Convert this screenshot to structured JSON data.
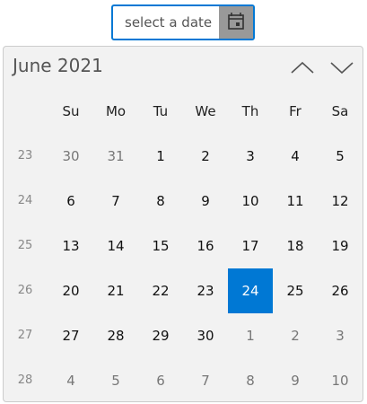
{
  "input": {
    "placeholder": "select a date",
    "icon": "calendar-icon"
  },
  "calendar": {
    "title": "June 2021",
    "selected": 24,
    "accent": "#0078d4",
    "days_of_week": [
      "Su",
      "Mo",
      "Tu",
      "We",
      "Th",
      "Fr",
      "Sa"
    ],
    "weeks": [
      {
        "week": "23",
        "days": [
          "30",
          "31",
          "1",
          "2",
          "3",
          "4",
          "5"
        ],
        "other": [
          true,
          true,
          false,
          false,
          false,
          false,
          false
        ]
      },
      {
        "week": "24",
        "days": [
          "6",
          "7",
          "8",
          "9",
          "10",
          "11",
          "12"
        ],
        "other": [
          false,
          false,
          false,
          false,
          false,
          false,
          false
        ]
      },
      {
        "week": "25",
        "days": [
          "13",
          "14",
          "15",
          "16",
          "17",
          "18",
          "19"
        ],
        "other": [
          false,
          false,
          false,
          false,
          false,
          false,
          false
        ]
      },
      {
        "week": "26",
        "days": [
          "20",
          "21",
          "22",
          "23",
          "24",
          "25",
          "26"
        ],
        "other": [
          false,
          false,
          false,
          false,
          false,
          false,
          false
        ]
      },
      {
        "week": "27",
        "days": [
          "27",
          "28",
          "29",
          "30",
          "1",
          "2",
          "3"
        ],
        "other": [
          false,
          false,
          false,
          false,
          true,
          true,
          true
        ]
      },
      {
        "week": "28",
        "days": [
          "4",
          "5",
          "6",
          "7",
          "8",
          "9",
          "10"
        ],
        "other": [
          true,
          true,
          true,
          true,
          true,
          true,
          true
        ]
      }
    ]
  }
}
